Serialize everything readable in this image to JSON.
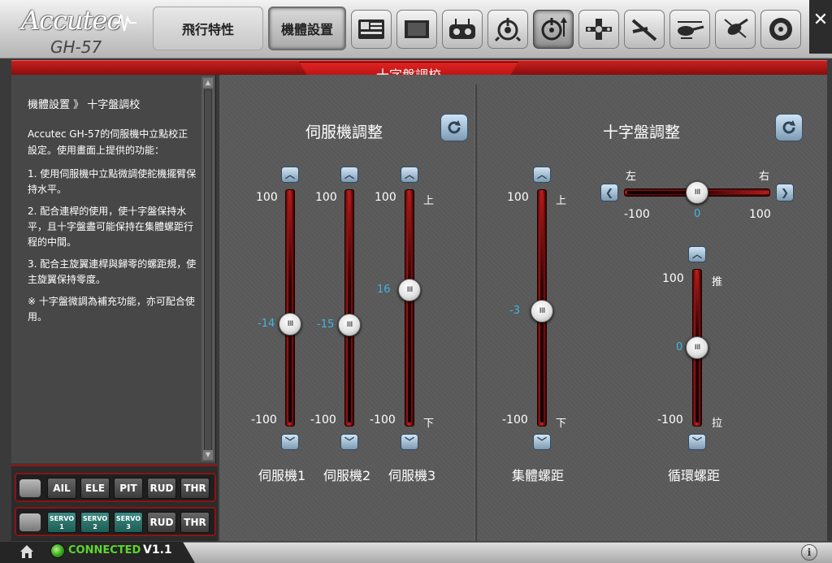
{
  "app": {
    "brand": "Accutec",
    "model": "GH-57"
  },
  "tabs": [
    {
      "label": "飛行特性",
      "active": false
    },
    {
      "label": "機體設置",
      "active": true
    }
  ],
  "toolbar_icons": [
    "setup-card-icon",
    "book-icon",
    "radio-transmitter-icon",
    "gyro-icon",
    "swashplate-icon",
    "servo-arm-icon",
    "tail-rotor-icon",
    "helicopter-icon",
    "helicopter-flip-icon",
    "disc-icon"
  ],
  "header": {
    "title": "十字盤調校"
  },
  "help": {
    "title": "機體設置 》 十字盤調校",
    "intro": "Accutec GH-57的伺服機中立點校正設定。使用畫面上提供的功能：",
    "items": [
      "1. 使用伺服機中立點微調使舵機擺臂保持水平。",
      "2. 配合連桿的使用，使十字盤保持水平，且十字盤盡可能保持在集體螺距行程的中間。",
      "3. 配合主旋翼連桿與歸零的螺距規，使主旋翼保持零度。",
      "※ 十字盤微調為補充功能，亦可配合使用。"
    ]
  },
  "servo_panel": {
    "title": "伺服機調整",
    "sliders": [
      {
        "name": "伺服機1",
        "value": -14,
        "max_label": "100",
        "min_label": "-100",
        "up_label": "",
        "down_label": ""
      },
      {
        "name": "伺服機2",
        "value": -15,
        "max_label": "100",
        "min_label": "-100",
        "up_label": "",
        "down_label": ""
      },
      {
        "name": "伺服機3",
        "value": 16,
        "max_label": "100",
        "min_label": "-100",
        "up_label": "上",
        "down_label": "下"
      },
      {
        "name": "集體螺距",
        "value": -3,
        "max_label": "100",
        "min_label": "-100",
        "up_label": "上",
        "down_label": "下"
      }
    ]
  },
  "swash_panel": {
    "title": "十字盤調整",
    "roll": {
      "value": 0,
      "left_label": "左",
      "right_label": "右",
      "min_label": "-100",
      "max_label": "100"
    },
    "cyclic": {
      "name": "循環螺距",
      "value": 0,
      "max_label": "100",
      "min_label": "-100",
      "up_label": "推",
      "down_label": "拉"
    }
  },
  "channels": {
    "row1": [
      "AIL",
      "ELE",
      "PIT",
      "RUD",
      "THR"
    ],
    "row2": [
      {
        "line1": "SERVO",
        "line2": "1"
      },
      {
        "line1": "SERVO",
        "line2": "2"
      },
      {
        "line1": "SERVO",
        "line2": "3"
      },
      {
        "line1": "RUD",
        "line2": ""
      },
      {
        "line1": "THR",
        "line2": ""
      }
    ]
  },
  "status": {
    "connection": "CONNECTED",
    "version": "V1.1"
  },
  "colors": {
    "accent_red": "#c62020",
    "value_blue": "#3fb6e2",
    "connected_green": "#5cd62d"
  }
}
